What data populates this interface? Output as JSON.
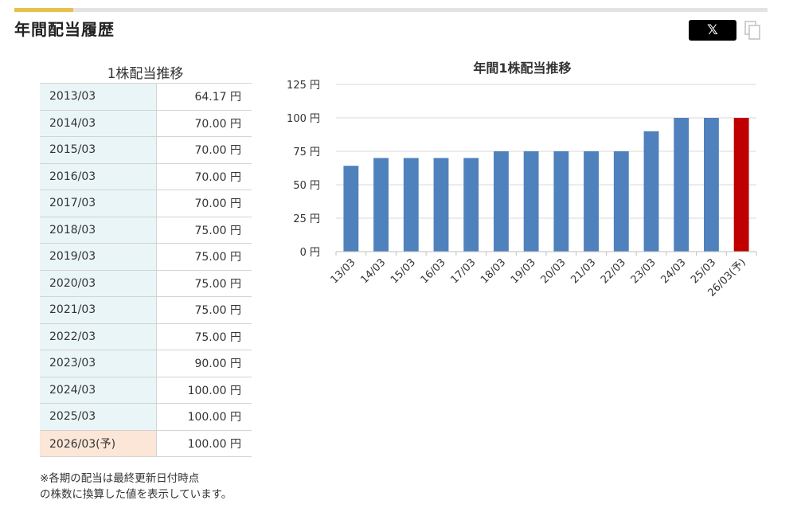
{
  "section": {
    "title": "年間配当履歴"
  },
  "share": {
    "x_label": "𝕏"
  },
  "table": {
    "caption": "1株配当推移",
    "rows": [
      {
        "period": "2013/03",
        "amount": "64.17 円"
      },
      {
        "period": "2014/03",
        "amount": "70.00 円"
      },
      {
        "period": "2015/03",
        "amount": "70.00 円"
      },
      {
        "period": "2016/03",
        "amount": "70.00 円"
      },
      {
        "period": "2017/03",
        "amount": "70.00 円"
      },
      {
        "period": "2018/03",
        "amount": "75.00 円"
      },
      {
        "period": "2019/03",
        "amount": "75.00 円"
      },
      {
        "period": "2020/03",
        "amount": "75.00 円"
      },
      {
        "period": "2021/03",
        "amount": "75.00 円"
      },
      {
        "period": "2022/03",
        "amount": "75.00 円"
      },
      {
        "period": "2023/03",
        "amount": "90.00 円"
      },
      {
        "period": "2024/03",
        "amount": "100.00 円"
      },
      {
        "period": "2025/03",
        "amount": "100.00 円"
      },
      {
        "period": "2026/03(予)",
        "amount": "100.00 円"
      }
    ]
  },
  "note": {
    "line1": "※各期の配当は最終更新日付時点",
    "line2": "の株数に換算した値を表示しています。"
  },
  "chart_data": {
    "type": "bar",
    "title": "年間1株配当推移",
    "xlabel": "",
    "ylabel": "",
    "categories": [
      "13/03",
      "14/03",
      "15/03",
      "16/03",
      "17/03",
      "18/03",
      "19/03",
      "20/03",
      "21/03",
      "22/03",
      "23/03",
      "24/03",
      "25/03",
      "26/03(予)"
    ],
    "values": [
      64.17,
      70,
      70,
      70,
      70,
      75,
      75,
      75,
      75,
      75,
      90,
      100,
      100,
      100
    ],
    "forecast_index": 13,
    "ylim": [
      0,
      125
    ],
    "yticks": [
      0,
      25,
      50,
      75,
      100,
      125
    ],
    "ytick_suffix": " 円",
    "grid": true,
    "colors": {
      "bar": "#4f81bd",
      "forecast": "#c00000",
      "grid": "#d9d9d9"
    }
  }
}
